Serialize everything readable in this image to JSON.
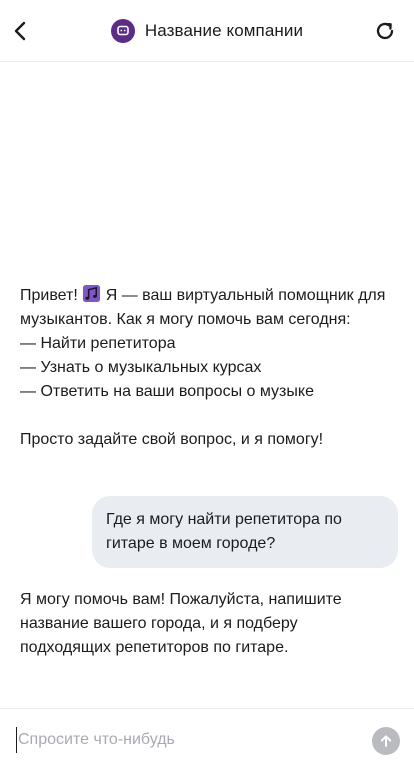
{
  "header": {
    "title": "Название компании",
    "back_icon": "chevron-left-icon",
    "refresh_icon": "refresh-icon",
    "logo_icon": "chat-bubble-icon",
    "brand_color": "#5b2d86"
  },
  "messages": [
    {
      "role": "bot",
      "text_before_emoji": "Привет! ",
      "emoji": "musical-notes-icon",
      "text_after_emoji": " Я — ваш виртуальный помощник для музыкантов. Как я могу помочь вам сегодня:\n— Найти репетитора\n— Узнать о музыкальных курсах\n— Ответить на ваши вопросы о музыке\n\nПросто задайте свой вопрос, и я помогу!"
    },
    {
      "role": "user",
      "text": "Где я могу найти репетитора по гитаре в моем городе?"
    },
    {
      "role": "bot",
      "text": "Я могу помочь вам! Пожалуйста, напишите название вашего города, и я подберу подходящих репетиторов по гитаре."
    }
  ],
  "composer": {
    "placeholder": "Спросите что-нибудь",
    "value": "",
    "send_icon": "arrow-up-icon"
  },
  "colors": {
    "user_bubble": "#e9edf1",
    "send_button": "#b9bbc0",
    "text": "#1b1b1f",
    "placeholder": "#a8aab0"
  }
}
